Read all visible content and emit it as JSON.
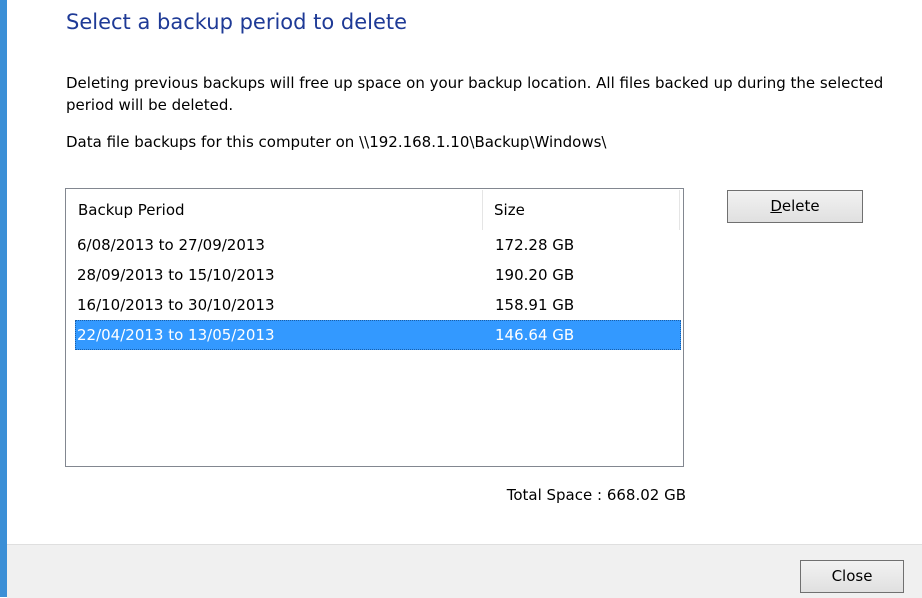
{
  "dialog": {
    "title": "Select a backup period to delete",
    "description": "Deleting previous backups will free up space on your backup location. All files backed up during the selected period will be deleted.",
    "location_text": "Data file backups for this computer on \\\\192.168.1.10\\Backup\\Windows\\"
  },
  "list": {
    "columns": {
      "period": "Backup Period",
      "size": "Size"
    },
    "rows": [
      {
        "period": "6/08/2013 to 27/09/2013",
        "size": "172.28 GB",
        "selected": false
      },
      {
        "period": "28/09/2013 to 15/10/2013",
        "size": "190.20 GB",
        "selected": false
      },
      {
        "period": "16/10/2013 to 30/10/2013",
        "size": "158.91 GB",
        "selected": false
      },
      {
        "period": "22/04/2013 to 13/05/2013",
        "size": "146.64 GB",
        "selected": true
      }
    ]
  },
  "buttons": {
    "delete_mnemonic": "D",
    "delete_rest": "elete",
    "close": "Close"
  },
  "total_space": "Total Space : 668.02 GB",
  "colors": {
    "title": "#1e3a96",
    "selection": "#3399ff",
    "window_border": "#3b8fd6",
    "footer": "#f0f0f0"
  }
}
